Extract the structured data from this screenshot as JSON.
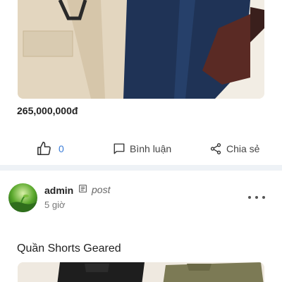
{
  "post1": {
    "price": "265,000,000đ",
    "actions": {
      "like_count": "0",
      "comment_label": "Bình luận",
      "share_label": "Chia sẻ"
    }
  },
  "post2": {
    "author": "admin",
    "post_type": "post",
    "time": "5 giờ",
    "title": "Quần Shorts Geared"
  },
  "colors": {
    "page_bg": "#eef2f6",
    "card_bg": "#ffffff",
    "like_count": "#3b7dd8",
    "text": "#222222"
  },
  "icons": [
    "thumbs-up-icon",
    "comment-icon",
    "share-icon",
    "document-icon",
    "more-icon"
  ]
}
